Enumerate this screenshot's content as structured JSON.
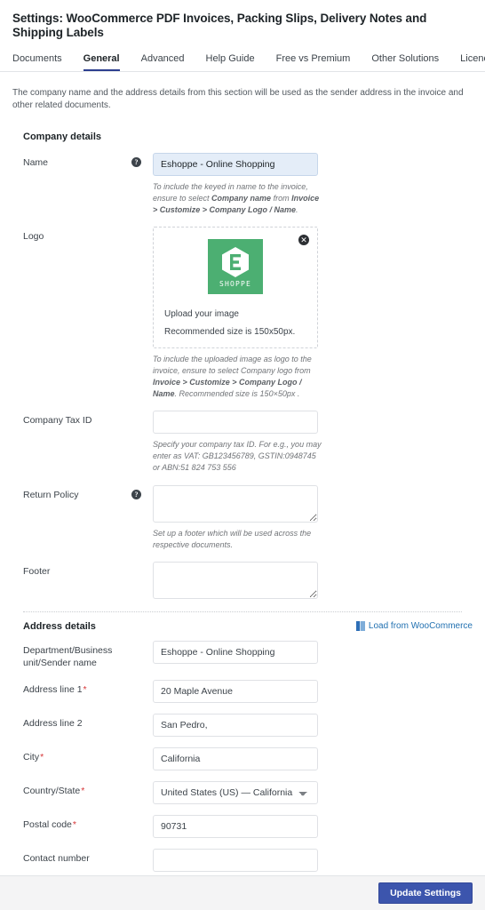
{
  "header": {
    "title": "Settings: WooCommerce PDF Invoices, Packing Slips, Delivery Notes and Shipping Labels",
    "tabs": [
      {
        "label": "Documents",
        "active": false
      },
      {
        "label": "General",
        "active": true
      },
      {
        "label": "Advanced",
        "active": false
      },
      {
        "label": "Help Guide",
        "active": false
      },
      {
        "label": "Free vs Premium",
        "active": false
      },
      {
        "label": "Other Solutions",
        "active": false
      },
      {
        "label": "Licence",
        "active": false
      }
    ]
  },
  "intro": "The company name and the address details from this section will be used as the sender address in the invoice and other related documents.",
  "company_details": {
    "heading": "Company details",
    "name": {
      "label": "Name",
      "help_icon": "help-circle-icon",
      "value": "Eshoppe - Online Shopping",
      "placeholder": "",
      "desc_plain_1": "To include the keyed in name to the invoice, ensure to select ",
      "desc_bold_1": "Company name",
      "desc_plain_2": " from ",
      "desc_bold_2": "Invoice > Customize > Company Logo / Name",
      "desc_plain_3": "."
    },
    "logo": {
      "label": "Logo",
      "remove_icon": "close-circle-icon",
      "image_alt": "Eshoppe logo",
      "logo_word": "SHOPPE",
      "logo_letter": "E",
      "logo_color": "#4caf72",
      "upload_text": "Upload your image",
      "recommended_text": "Recommended size is 150x50px.",
      "desc_plain_1": "To include the uploaded image as logo to the invoice, ensure to select Company logo from ",
      "desc_bold_1": "Invoice > Customize > Company Logo / Name",
      "desc_plain_2": ". Recommended size is 150×50px ."
    },
    "tax_id": {
      "label": "Company Tax ID",
      "value": "",
      "placeholder": "",
      "desc": "Specify your company tax ID. For e.g., you may enter as VAT: GB123456789, GSTIN:0948745 or ABN:51 824 753 556"
    },
    "return_policy": {
      "label": "Return Policy",
      "help_icon": "help-circle-icon",
      "value": "",
      "placeholder": "",
      "desc": "Set up a footer which will be used across the respective documents."
    },
    "footer_field": {
      "label": "Footer",
      "value": "",
      "placeholder": ""
    }
  },
  "address_details": {
    "heading": "Address details",
    "load_link": {
      "label": "Load from WooCommerce",
      "icon": "book-icon",
      "color": "#2271b1"
    },
    "fields": [
      {
        "name": "department-business-unit-sender-name",
        "label": "Department/Business unit/Sender name",
        "required": false,
        "type": "text",
        "value": "Eshoppe - Online Shopping",
        "placeholder": ""
      },
      {
        "name": "address-line-1",
        "label": "Address line 1",
        "required": true,
        "type": "text",
        "value": "20 Maple Avenue",
        "placeholder": ""
      },
      {
        "name": "address-line-2",
        "label": "Address line 2",
        "required": false,
        "type": "text",
        "value": "San Pedro,",
        "placeholder": ""
      },
      {
        "name": "city",
        "label": "City",
        "required": true,
        "type": "text",
        "value": "California",
        "placeholder": ""
      },
      {
        "name": "country-state",
        "label": "Country/State",
        "required": true,
        "type": "select",
        "value": "United States (US) — California",
        "options": [
          "United States (US) — California"
        ]
      },
      {
        "name": "postal-code",
        "label": "Postal code",
        "required": true,
        "type": "text",
        "value": "90731",
        "placeholder": ""
      },
      {
        "name": "contact-number",
        "label": "Contact number",
        "required": false,
        "type": "text",
        "value": "",
        "placeholder": ""
      }
    ]
  },
  "footer": {
    "update_button": "Update Settings",
    "button_color": "#3c55ad"
  },
  "required_marker": "*"
}
